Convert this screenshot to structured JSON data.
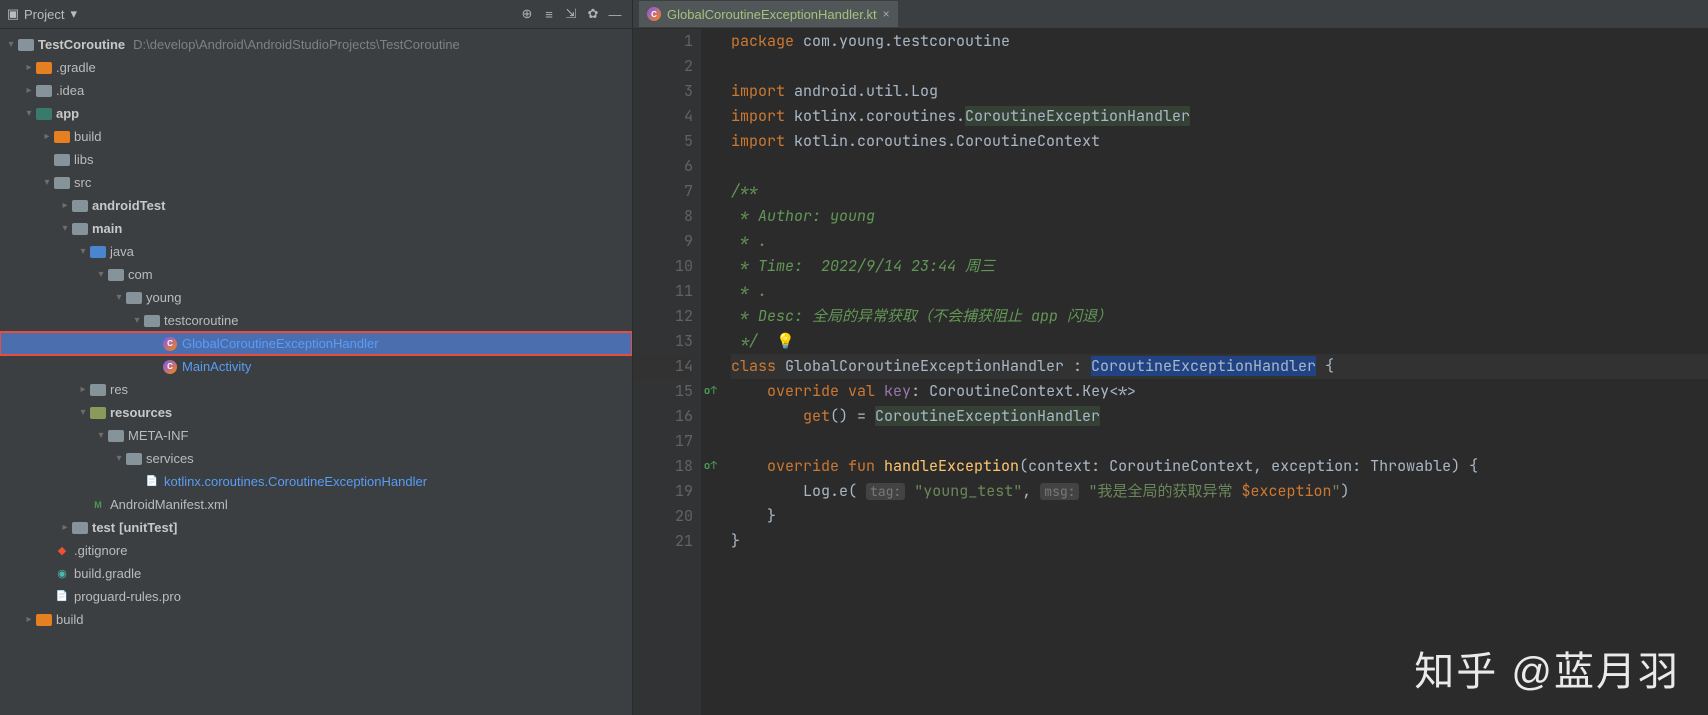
{
  "sidebar": {
    "title": "Project",
    "rootName": "TestCoroutine",
    "rootPath": "D:\\develop\\Android\\AndroidStudioProjects\\TestCoroutine",
    "nodes": {
      "gradle": ".gradle",
      "idea": ".idea",
      "app": "app",
      "build": "build",
      "libs": "libs",
      "src": "src",
      "androidTest": "androidTest",
      "main": "main",
      "java": "java",
      "com": "com",
      "young": "young",
      "testcoroutine": "testcoroutine",
      "globalHandler": "GlobalCoroutineExceptionHandler",
      "mainActivity": "MainActivity",
      "res": "res",
      "resources": "resources",
      "metaInf": "META-INF",
      "services": "services",
      "serviceFile": "kotlinx.coroutines.CoroutineExceptionHandler",
      "manifest": "AndroidManifest.xml",
      "test": "test",
      "testSuffix": "[unitTest]",
      "gitignore": ".gitignore",
      "buildGradle": "build.gradle",
      "proguard": "proguard-rules.pro",
      "rootBuild": "build"
    }
  },
  "editor": {
    "tabLabel": "GlobalCoroutineExceptionHandler.kt",
    "lineNumbers": [
      "1",
      "2",
      "3",
      "4",
      "5",
      "6",
      "7",
      "8",
      "9",
      "10",
      "11",
      "12",
      "13",
      "14",
      "15",
      "16",
      "17",
      "18",
      "19",
      "20",
      "21"
    ],
    "code": {
      "l1_kw": "package",
      "l1_pkg": " com.young.testcoroutine",
      "l3_kw": "import",
      "l3_rest": " android.util.Log",
      "l4_kw": "import",
      "l4_rest": " kotlinx.coroutines.",
      "l4_hl": "CoroutineExceptionHandler",
      "l5_kw": "import",
      "l5_rest": " kotlin.coroutines.CoroutineContext",
      "l7": "/**",
      "l8": " * Author: young",
      "l9": " * .",
      "l10": " * Time:  2022/9/14 23:44 周三",
      "l11": " * .",
      "l12": " * Desc: 全局的异常获取（不会捕获阻止 app 闪退）",
      "l13": " */",
      "l14_kw": "class",
      "l14_name": " GlobalCoroutineExceptionHandler : ",
      "l14_super": "CoroutineExceptionHandler",
      "l14_brace": " {",
      "l15_kw1": "override",
      "l15_kw2": " val ",
      "l15_key": "key",
      "l15_rest": ": CoroutineContext.Key<*>",
      "l16_get": "get",
      "l16_rest": "() = ",
      "l16_type": "CoroutineExceptionHandler",
      "l18_kw1": "override",
      "l18_kw2": " fun ",
      "l18_fn": "handleException",
      "l18_sig": "(context: CoroutineContext, exception: Throwable) {",
      "l19_call": "Log.e( ",
      "l19_h1": "tag:",
      "l19_s1": "\"young_test\"",
      "l19_c": ", ",
      "l19_h2": "msg:",
      "l19_s2a": "\"我是全局的获取异常 ",
      "l19_var": "$exception",
      "l19_s2b": "\"",
      "l19_end": ")",
      "l20": "}",
      "l21": "}"
    }
  },
  "watermark": "知乎 @蓝月羽"
}
